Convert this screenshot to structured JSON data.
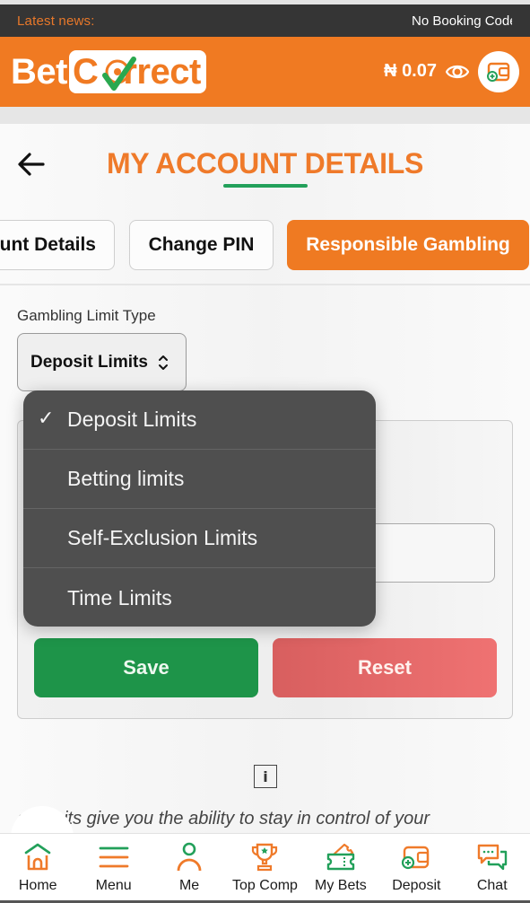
{
  "news": {
    "label": "Latest news:",
    "ticker": "No Booking Code"
  },
  "header": {
    "logo_left": "Bet",
    "logo_right": "Correct",
    "logo_right_prefix": "C",
    "logo_right_suffix": "rrect",
    "balance": "₦ 0.07",
    "brand_color": "#f07a22",
    "accent_green": "#22a05a"
  },
  "page": {
    "title": "MY ACCOUNT DETAILS",
    "tabs": [
      {
        "label": "Account Details",
        "visible_label": "unt Details",
        "active": false
      },
      {
        "label": "Change PIN",
        "active": false
      },
      {
        "label": "Responsible Gambling",
        "active": true
      }
    ]
  },
  "form": {
    "limit_type_label": "Gambling Limit Type",
    "limit_type_selected": "Deposit Limits",
    "save_label": "Save",
    "reset_label": "Reset",
    "description": "Deposit limits give you the ability to stay in control of your",
    "description_visible": "    sit limits give you the ability to stay in control of your"
  },
  "dropdown": {
    "options": [
      {
        "label": "Deposit Limits",
        "selected": true
      },
      {
        "label": "Betting limits",
        "selected": false
      },
      {
        "label": "Self-Exclusion Limits",
        "selected": false
      },
      {
        "label": "Time Limits",
        "selected": false
      }
    ],
    "check_glyph": "✓"
  },
  "bottom_nav": [
    {
      "label": "Home",
      "icon": "home-icon"
    },
    {
      "label": "Menu",
      "icon": "menu-icon"
    },
    {
      "label": "Me",
      "icon": "user-icon"
    },
    {
      "label": "Top Comp",
      "icon": "trophy-icon"
    },
    {
      "label": "My Bets",
      "icon": "ticket-icon"
    },
    {
      "label": "Deposit",
      "icon": "wallet-icon"
    },
    {
      "label": "Chat",
      "icon": "chat-icon"
    }
  ]
}
